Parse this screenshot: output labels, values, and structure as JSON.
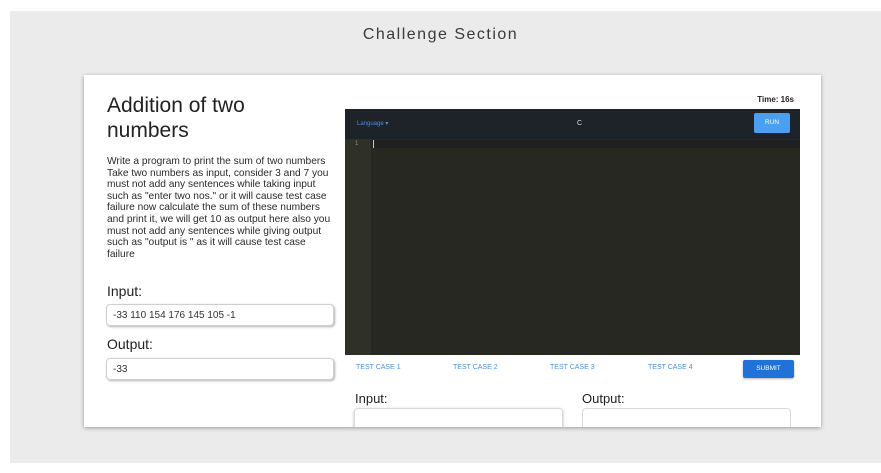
{
  "page": {
    "title": "Challenge Section"
  },
  "problem": {
    "title": "Addition of two numbers",
    "description": "Write a program to print the sum of two numbers Take two numbers as input, consider 3 and 7 you must not add any sentences while taking input such as \"enter two nos.\" or it will cause test case failure now calculate the sum of these numbers and print it, we will get 10 as output here also you must not add any sentences while giving output such as \"output is \" as it will cause test case failure",
    "input_label": "Input:",
    "input_value": "-33 110 154 176 145 105 -1",
    "output_label": "Output:",
    "output_value": "-33"
  },
  "timer": "Time: 16s",
  "editor": {
    "language_select": "Language ▾",
    "language": "C",
    "run_label": "RUN",
    "line_number": "1",
    "colors": {
      "background": "#272822",
      "toolbar": "#1e2229",
      "gutter": "#2f3129"
    }
  },
  "test_cases": {
    "tabs": [
      "TEST CASE 1",
      "TEST CASE 2",
      "TEST CASE 3",
      "TEST CASE 4"
    ],
    "submit_label": "SUBMIT",
    "input_label": "Input:",
    "output_label": "Output:"
  },
  "colors": {
    "accent": "#1f72d8",
    "link": "#4a90e2"
  }
}
